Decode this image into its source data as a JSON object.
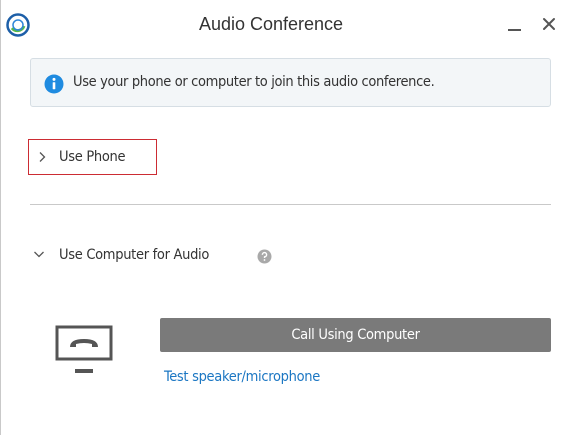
{
  "window": {
    "title": "Audio Conference",
    "app_icon": "app-logo-icon",
    "controls": {
      "minimize_icon": "minimize-icon",
      "close_icon": "close-icon"
    }
  },
  "info_banner": {
    "icon": "info-icon",
    "text": "Use your phone or computer to join this audio conference."
  },
  "sections": {
    "use_phone": {
      "label": "Use Phone",
      "icon": "chevron-right-icon",
      "expanded": false
    },
    "use_computer": {
      "label": "Use Computer for Audio",
      "icon": "chevron-down-icon",
      "expanded": true,
      "help_icon": "help-icon",
      "device_icon": "computer-audio-icon",
      "call_button_label": "Call Using Computer",
      "test_link_label": "Test speaker/microphone"
    }
  },
  "colors": {
    "highlight_border": "#cc2c33",
    "info_blue": "#1f8be0",
    "link_blue": "#1c77c3",
    "button_gray": "#7a7a7a",
    "divider": "#c9c9c9"
  }
}
